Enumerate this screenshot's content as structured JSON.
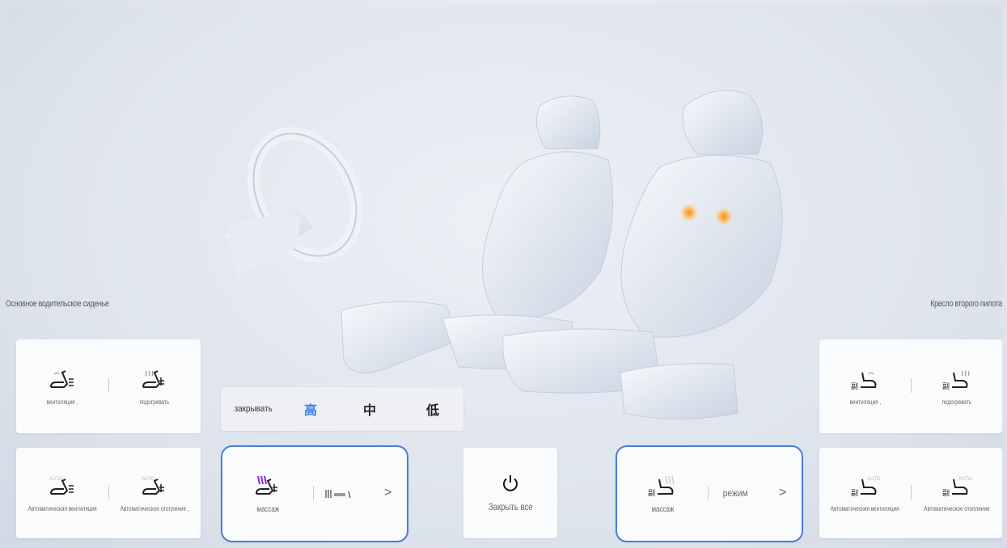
{
  "left_panel": {
    "title": "Основное водительское сиденье",
    "top_card": {
      "cells": [
        {
          "label": "вентиляция ,"
        },
        {
          "label": "подогревать"
        }
      ]
    },
    "bottom_card": {
      "cells": [
        {
          "label": "Автоматическая вентиляция",
          "badge": "AUTO"
        },
        {
          "label": "Автоматическое отопление ,",
          "badge": "AUTO"
        }
      ]
    }
  },
  "right_panel": {
    "title": "Кресло второго пилота",
    "top_card": {
      "cells": [
        {
          "label": "вентиляция ,"
        },
        {
          "label": "подогревать"
        }
      ]
    },
    "bottom_card": {
      "cells": [
        {
          "label": "Автоматическая вентиляция",
          "badge": "AUTO"
        },
        {
          "label": "Автоматическое отопление",
          "badge": "AUTO"
        }
      ]
    }
  },
  "intensity_popup": {
    "options": [
      {
        "label": "закрывать"
      },
      {
        "label": "高",
        "active": true
      },
      {
        "label": "中"
      },
      {
        "label": "低"
      }
    ]
  },
  "massage_left": {
    "label": "массаж",
    "mode_text": "",
    "chevron": ">"
  },
  "close_all": {
    "label": "Закрыть все"
  },
  "massage_right": {
    "label": "массаж",
    "mode_label": "режим",
    "chevron": ">"
  },
  "colors": {
    "accent": "#3b7ce5",
    "selected_border": "#4a7fd6",
    "massage_active": "#8a2be2",
    "heat_spot": "#ff9a1a"
  }
}
